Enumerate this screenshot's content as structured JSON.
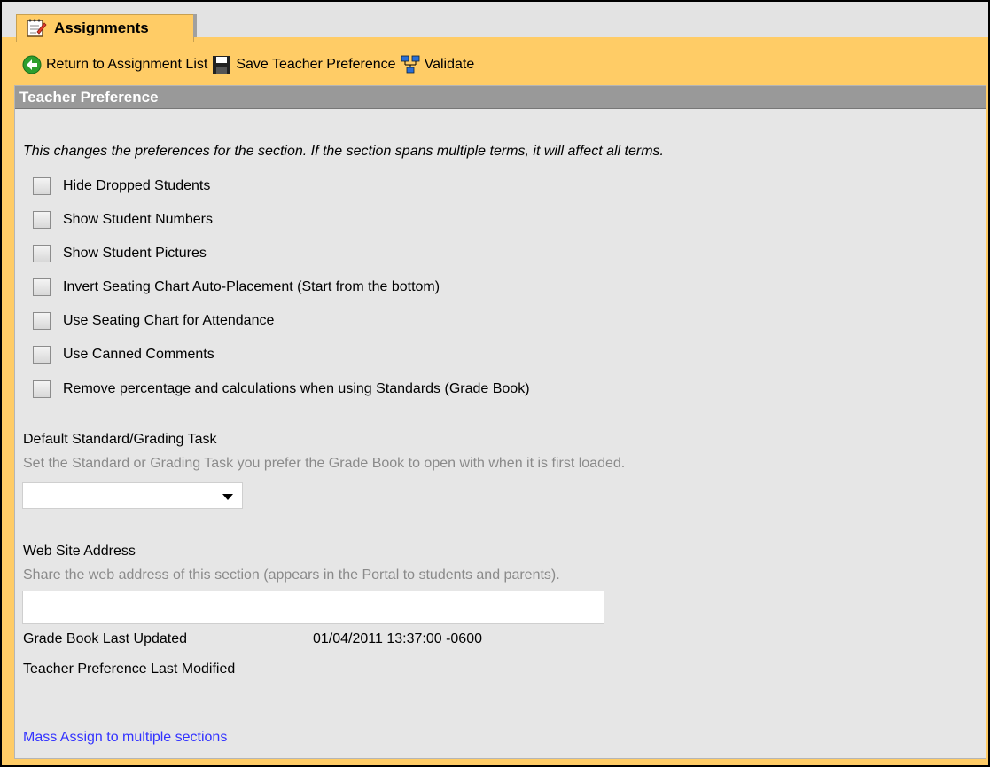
{
  "tabs": [
    {
      "label": "Assignments",
      "icon": "notepad-icon"
    }
  ],
  "toolbar": {
    "return_label": "Return to Assignment List",
    "save_label": "Save Teacher Preference",
    "validate_label": "Validate"
  },
  "panel": {
    "title": "Teacher Preference",
    "description": "This changes the preferences for the section. If the section spans multiple terms, it will affect all terms.",
    "checkboxes": [
      {
        "label": "Hide Dropped Students",
        "checked": false
      },
      {
        "label": "Show Student Numbers",
        "checked": false
      },
      {
        "label": "Show Student Pictures",
        "checked": false
      },
      {
        "label": "Invert Seating Chart Auto-Placement (Start from the bottom)",
        "checked": false
      },
      {
        "label": "Use Seating Chart for Attendance",
        "checked": false
      },
      {
        "label": "Use Canned Comments",
        "checked": false
      },
      {
        "label": "Remove percentage and calculations when using Standards (Grade Book)",
        "checked": false
      }
    ],
    "default_task": {
      "heading": "Default Standard/Grading Task",
      "hint": "Set the Standard or Grading Task you prefer the Grade Book to open with when it is first loaded.",
      "selected": ""
    },
    "website": {
      "heading": "Web Site Address",
      "hint": "Share the web address of this section (appears in the Portal to students and parents).",
      "value": ""
    },
    "meta": {
      "gradebook_label": "Grade Book Last Updated",
      "gradebook_value": "01/04/2011 13:37:00 -0600",
      "pref_label": "Teacher Preference Last Modified"
    },
    "mass_assign_link": "Mass Assign to multiple sections"
  },
  "colors": {
    "accent": "#ffcc66",
    "panel_header": "#999999",
    "panel_bg": "#e6e6e6",
    "link": "#3333ff"
  }
}
